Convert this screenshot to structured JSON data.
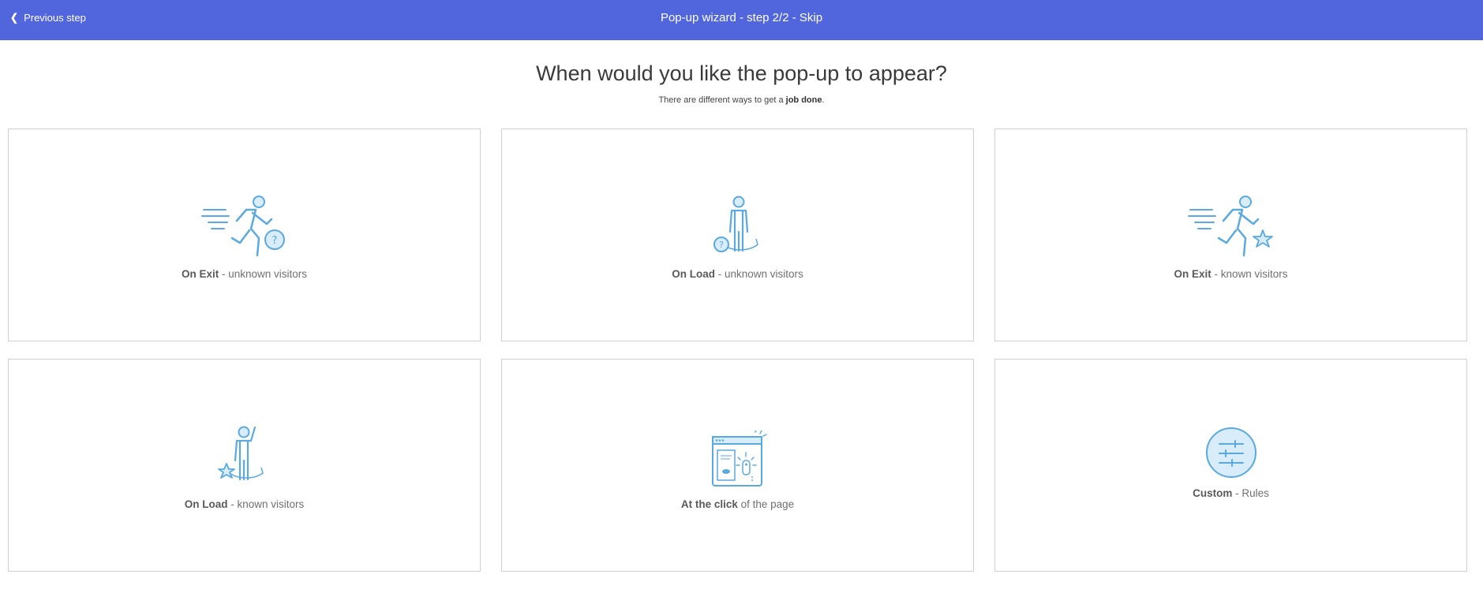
{
  "header": {
    "back_label": "Previous step",
    "title": "Pop-up wizard - step 2/2 - Skip"
  },
  "main": {
    "heading": "When would you like the pop-up to appear?",
    "subheading_prefix": "There are different ways to get a ",
    "subheading_bold": "job done",
    "subheading_suffix": "."
  },
  "options": [
    {
      "bold": "On Exit",
      "rest": " - unknown visitors",
      "icon": "running-person-question-icon"
    },
    {
      "bold": "On Load",
      "rest": " - unknown visitors",
      "icon": "standing-person-question-icon"
    },
    {
      "bold": "On Exit",
      "rest": " - known visitors",
      "icon": "running-person-star-icon"
    },
    {
      "bold": "On Load",
      "rest": " - known visitors",
      "icon": "waving-person-star-icon"
    },
    {
      "bold": "At the click",
      "rest": " of the page",
      "icon": "browser-click-icon"
    },
    {
      "bold": "Custom",
      "rest": " - Rules",
      "icon": "sliders-icon"
    }
  ],
  "colors": {
    "header_bg": "#5166dc",
    "icon_stroke": "#5aa9e0",
    "icon_fill": "#d8ecfa"
  }
}
